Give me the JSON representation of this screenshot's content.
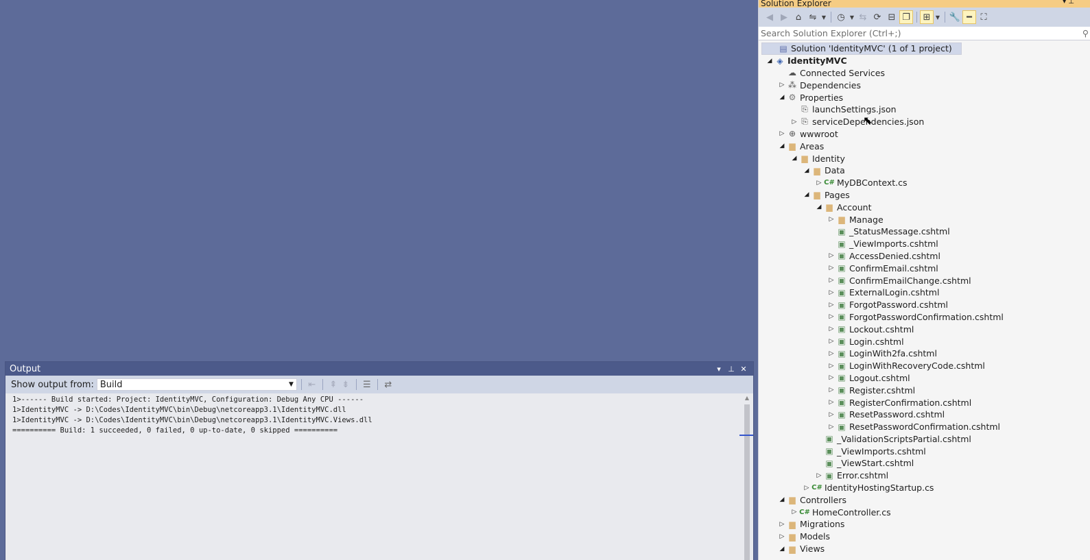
{
  "output": {
    "title": "Output",
    "show_from_label": "Show output from:",
    "source_value": "Build",
    "lines": [
      "1>------ Build started: Project: IdentityMVC, Configuration: Debug Any CPU ------",
      "1>IdentityMVC -> D:\\Codes\\IdentityMVC\\bin\\Debug\\netcoreapp3.1\\IdentityMVC.dll",
      "1>IdentityMVC -> D:\\Codes\\IdentityMVC\\bin\\Debug\\netcoreapp3.1\\IdentityMVC.Views.dll",
      "========== Build: 1 succeeded, 0 failed, 0 up-to-date, 0 skipped =========="
    ]
  },
  "solution_explorer": {
    "title": "Solution Explorer",
    "search_placeholder": "Search Solution Explorer (Ctrl+;)",
    "items": [
      {
        "label": "Solution 'IdentityMVC' (1 of 1 project)",
        "level": 0,
        "exp": "",
        "icon": "sln",
        "selected": true
      },
      {
        "label": "IdentityMVC",
        "level": 0,
        "exp": "open",
        "icon": "proj",
        "bold": true
      },
      {
        "label": "Connected Services",
        "level": 1,
        "exp": "",
        "icon": "conn"
      },
      {
        "label": "Dependencies",
        "level": 1,
        "exp": "closed",
        "icon": "dep"
      },
      {
        "label": "Properties",
        "level": 1,
        "exp": "open",
        "icon": "gear"
      },
      {
        "label": "launchSettings.json",
        "level": 2,
        "exp": "",
        "icon": "json"
      },
      {
        "label": "serviceDependencies.json",
        "level": 2,
        "exp": "closed",
        "icon": "json"
      },
      {
        "label": "wwwroot",
        "level": 1,
        "exp": "closed",
        "icon": "globe"
      },
      {
        "label": "Areas",
        "level": 1,
        "exp": "open",
        "icon": "folder"
      },
      {
        "label": "Identity",
        "level": 2,
        "exp": "open",
        "icon": "folder"
      },
      {
        "label": "Data",
        "level": 3,
        "exp": "open",
        "icon": "folder"
      },
      {
        "label": "MyDBContext.cs",
        "level": 4,
        "exp": "closed",
        "icon": "cs"
      },
      {
        "label": "Pages",
        "level": 3,
        "exp": "open",
        "icon": "folder"
      },
      {
        "label": "Account",
        "level": 4,
        "exp": "open",
        "icon": "folder"
      },
      {
        "label": "Manage",
        "level": 5,
        "exp": "closed",
        "icon": "folder"
      },
      {
        "label": "_StatusMessage.cshtml",
        "level": 5,
        "exp": "",
        "icon": "page"
      },
      {
        "label": "_ViewImports.cshtml",
        "level": 5,
        "exp": "",
        "icon": "page"
      },
      {
        "label": "AccessDenied.cshtml",
        "level": 5,
        "exp": "closed",
        "icon": "page"
      },
      {
        "label": "ConfirmEmail.cshtml",
        "level": 5,
        "exp": "closed",
        "icon": "page"
      },
      {
        "label": "ConfirmEmailChange.cshtml",
        "level": 5,
        "exp": "closed",
        "icon": "page"
      },
      {
        "label": "ExternalLogin.cshtml",
        "level": 5,
        "exp": "closed",
        "icon": "page"
      },
      {
        "label": "ForgotPassword.cshtml",
        "level": 5,
        "exp": "closed",
        "icon": "page"
      },
      {
        "label": "ForgotPasswordConfirmation.cshtml",
        "level": 5,
        "exp": "closed",
        "icon": "page"
      },
      {
        "label": "Lockout.cshtml",
        "level": 5,
        "exp": "closed",
        "icon": "page"
      },
      {
        "label": "Login.cshtml",
        "level": 5,
        "exp": "closed",
        "icon": "page"
      },
      {
        "label": "LoginWith2fa.cshtml",
        "level": 5,
        "exp": "closed",
        "icon": "page"
      },
      {
        "label": "LoginWithRecoveryCode.cshtml",
        "level": 5,
        "exp": "closed",
        "icon": "page"
      },
      {
        "label": "Logout.cshtml",
        "level": 5,
        "exp": "closed",
        "icon": "page"
      },
      {
        "label": "Register.cshtml",
        "level": 5,
        "exp": "closed",
        "icon": "page"
      },
      {
        "label": "RegisterConfirmation.cshtml",
        "level": 5,
        "exp": "closed",
        "icon": "page"
      },
      {
        "label": "ResetPassword.cshtml",
        "level": 5,
        "exp": "closed",
        "icon": "page"
      },
      {
        "label": "ResetPasswordConfirmation.cshtml",
        "level": 5,
        "exp": "closed",
        "icon": "page"
      },
      {
        "label": "_ValidationScriptsPartial.cshtml",
        "level": 4,
        "exp": "",
        "icon": "page"
      },
      {
        "label": "_ViewImports.cshtml",
        "level": 4,
        "exp": "",
        "icon": "page"
      },
      {
        "label": "_ViewStart.cshtml",
        "level": 4,
        "exp": "",
        "icon": "page"
      },
      {
        "label": "Error.cshtml",
        "level": 4,
        "exp": "closed",
        "icon": "page"
      },
      {
        "label": "IdentityHostingStartup.cs",
        "level": 3,
        "exp": "closed",
        "icon": "cs"
      },
      {
        "label": "Controllers",
        "level": 1,
        "exp": "open",
        "icon": "folder"
      },
      {
        "label": "HomeController.cs",
        "level": 2,
        "exp": "closed",
        "icon": "cs"
      },
      {
        "label": "Migrations",
        "level": 1,
        "exp": "closed",
        "icon": "folder"
      },
      {
        "label": "Models",
        "level": 1,
        "exp": "closed",
        "icon": "folder"
      },
      {
        "label": "Views",
        "level": 1,
        "exp": "open",
        "icon": "folder"
      }
    ]
  }
}
